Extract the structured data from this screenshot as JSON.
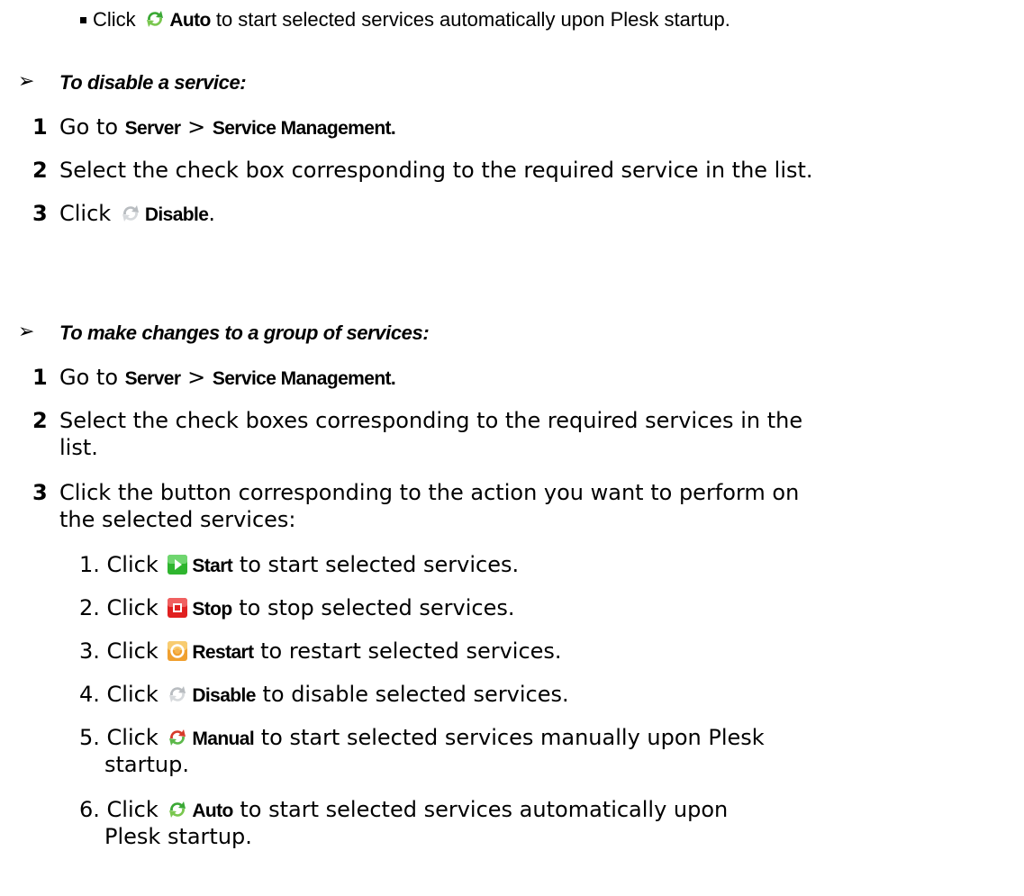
{
  "top_bullet": {
    "click": "Click",
    "action": "Auto",
    "text": " to start selected services automatically upon Plesk startup."
  },
  "disable_section": {
    "heading": "To disable a service:",
    "step1": {
      "num": "1",
      "go_to": "Go to ",
      "server": "Server",
      "sep": " > ",
      "service_mgmt": "Service Management."
    },
    "step2": {
      "num": "2",
      "text": "Select the check box corresponding to the required service in the list."
    },
    "step3": {
      "num": "3",
      "click": "Click ",
      "action": "Disable",
      "end": "."
    }
  },
  "group_section": {
    "heading": "To make changes to a group of services:",
    "step1": {
      "num": "1",
      "go_to": "Go to ",
      "server": "Server",
      "sep": " > ",
      "service_mgmt": "Service Management."
    },
    "step2": {
      "num": "2",
      "line1": "Select the check boxes corresponding to the required services in the",
      "line2": "list."
    },
    "step3": {
      "num": "3",
      "line1": "Click the button corresponding to the action you want to perform on",
      "line2": "the selected services:"
    },
    "substeps": [
      {
        "prefix": "1. Click ",
        "action": "Start",
        "text": " to start selected services.",
        "icon": "start-icon"
      },
      {
        "prefix": "2. Click ",
        "action": "Stop",
        "text": " to stop selected services.",
        "icon": "stop-icon"
      },
      {
        "prefix": "3. Click ",
        "action": "Restart",
        "text": " to restart selected services.",
        "icon": "restart-icon"
      },
      {
        "prefix": "4. Click ",
        "action": "Disable",
        "text": " to disable selected services.",
        "icon": "disable-icon"
      },
      {
        "prefix": "5. Click ",
        "action": "Manual",
        "text": " to start selected services manually upon Plesk",
        "text2": "startup.",
        "icon": "manual-icon"
      },
      {
        "prefix": "6. Click ",
        "action": "Auto",
        "text": " to start selected services automatically upon",
        "text2": "Plesk startup.",
        "icon": "auto-icon"
      }
    ]
  },
  "colors": {
    "auto_green": "#3aa835",
    "manual_red": "#d63a2a",
    "disable_grey": "#b8bcc0",
    "start_green": "#2fb52f",
    "stop_red": "#e02020",
    "restart_orange": "#f0a030"
  }
}
